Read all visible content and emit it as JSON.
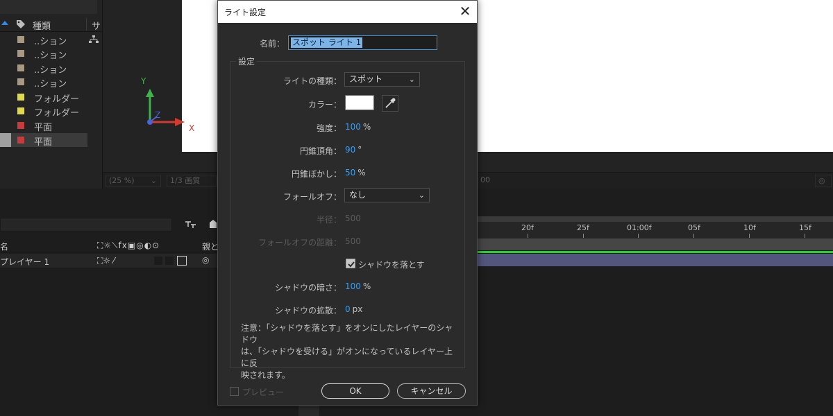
{
  "project_panel": {
    "header": {
      "type_label": "種類",
      "size_label": "サ"
    },
    "rows": [
      {
        "label": "..ション",
        "color": "#a89a82",
        "net_icon": true
      },
      {
        "label": "..ション",
        "color": "#a89a82"
      },
      {
        "label": "..ション",
        "color": "#a89a82"
      },
      {
        "label": "..ション",
        "color": "#a89a82"
      },
      {
        "label": "フォルダー",
        "color": "#e1d94d"
      },
      {
        "label": "フォルダー",
        "color": "#e1d94d"
      },
      {
        "label": "平面",
        "color": "#c63c3c"
      },
      {
        "label": "平面",
        "color": "#c63c3c",
        "selected": true
      }
    ]
  },
  "viewer": {
    "axes": {
      "y": "Y",
      "z": "Z",
      "x": "X"
    },
    "status": {
      "zoom": "(25 %)",
      "resolution": "1/3 画質",
      "right_value": "00"
    }
  },
  "timeline": {
    "columns_label": "名",
    "parent_label": "親と",
    "layer_name": "プレイヤー 1",
    "ruler_ticks": [
      "20f",
      "25f",
      "01:00f",
      "05f",
      "10f",
      "15f"
    ]
  },
  "dialog": {
    "title": "ライト設定",
    "close_glyph": "✕",
    "name_label": "名前：",
    "name_value": "スポット ライト 1",
    "group_label": "設定",
    "light_type_label": "ライトの種類：",
    "light_type_value": "スポット",
    "color_label": "カラー：",
    "color_value": "#ffffff",
    "intensity_label": "強度：",
    "intensity_value": "100",
    "intensity_unit": "%",
    "cone_angle_label": "円錐頂角：",
    "cone_angle_value": "90",
    "cone_angle_unit": "°",
    "cone_feather_label": "円錐ぼかし：",
    "cone_feather_value": "50",
    "cone_feather_unit": "%",
    "falloff_label": "フォールオフ：",
    "falloff_value": "なし",
    "radius_label": "半径：",
    "radius_value": "500",
    "falloff_distance_label": "フォールオフの距離：",
    "falloff_distance_value": "500",
    "casts_shadows_label": "シャドウを落とす",
    "casts_shadows_checked": true,
    "shadow_darkness_label": "シャドウの暗さ：",
    "shadow_darkness_value": "100",
    "shadow_darkness_unit": "%",
    "shadow_diffusion_label": "シャドウの拡散：",
    "shadow_diffusion_value": "0",
    "shadow_diffusion_unit": "px",
    "note_line1": "注意：「シャドウを落とす」をオンにしたレイヤーのシャドウ",
    "note_line2": "は、「シャドウを受ける」がオンになっているレイヤー上に反",
    "note_line3": "映されます。",
    "preview_label": "プレビュー",
    "ok_label": "OK",
    "cancel_label": "キャンセル"
  }
}
